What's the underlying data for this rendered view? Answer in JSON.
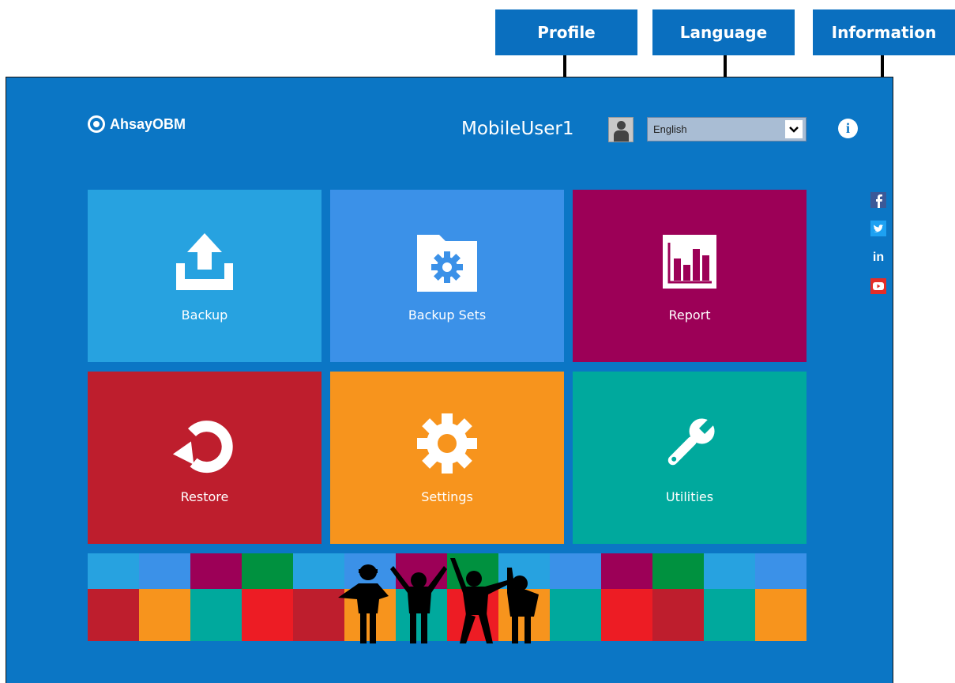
{
  "callouts": {
    "profile": "Profile",
    "language": "Language",
    "information": "Information"
  },
  "header": {
    "logo_text": "AhsayOBM",
    "username": "MobileUser1",
    "language_selected": "English"
  },
  "social": [
    "facebook-icon",
    "twitter-icon",
    "linkedin-icon",
    "youtube-icon"
  ],
  "tiles": [
    {
      "label": "Backup",
      "color": "#27a2e0",
      "icon": "upload-icon"
    },
    {
      "label": "Backup Sets",
      "color": "#3b91e8",
      "icon": "folder-gear-icon"
    },
    {
      "label": "Report",
      "color": "#9c0057",
      "icon": "bar-chart-icon"
    },
    {
      "label": "Restore",
      "color": "#be1e2d",
      "icon": "restore-icon"
    },
    {
      "label": "Settings",
      "color": "#f7941d",
      "icon": "gear-icon"
    },
    {
      "label": "Utilities",
      "color": "#00a99d",
      "icon": "wrench-icon"
    }
  ],
  "banner": {
    "top_colors": [
      "#27a2e0",
      "#3b91e8",
      "#9c0057",
      "#00913f",
      "#27a2e0",
      "#3b91e8",
      "#9c0057",
      "#00913f",
      "#27a2e0",
      "#3b91e8",
      "#9c0057",
      "#00913f",
      "#27a2e0",
      "#3b91e8"
    ],
    "bottom_colors": [
      "#be1e2d",
      "#f7941d",
      "#00a99d",
      "#ed1c24",
      "#be1e2d",
      "#f7941d",
      "#00a99d",
      "#ed1c24",
      "#f7941d",
      "#00a99d",
      "#ed1c24",
      "#be1e2d",
      "#00a99d",
      "#f7941d"
    ]
  }
}
